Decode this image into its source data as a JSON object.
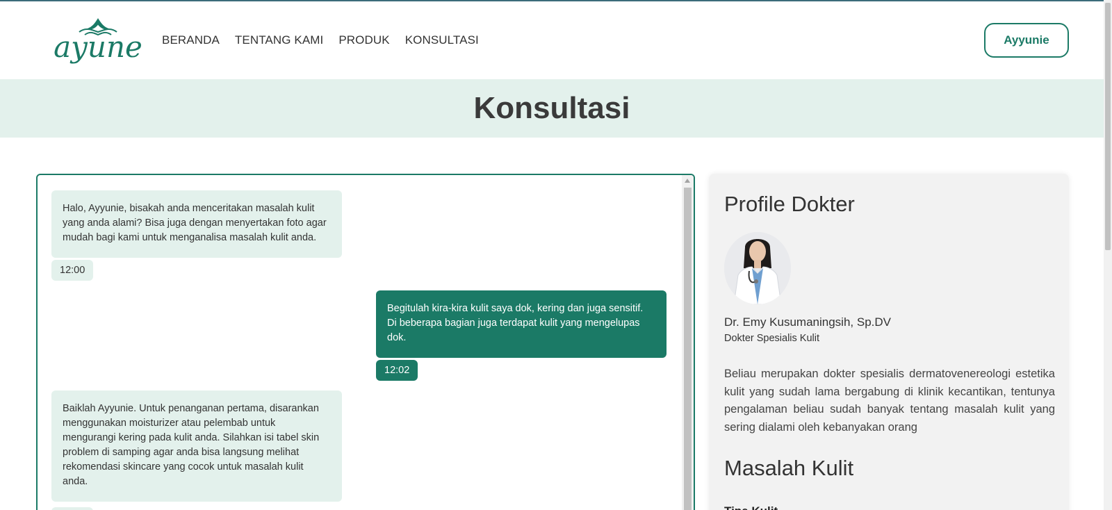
{
  "brand": {
    "logo_text": "ayune",
    "accent_color": "#1b7a66",
    "soft_color": "#e3f1ec"
  },
  "nav": {
    "items": [
      {
        "label": "BERANDA"
      },
      {
        "label": "TENTANG KAMI"
      },
      {
        "label": "PRODUK"
      },
      {
        "label": "KONSULTASI"
      }
    ],
    "user_button": "Ayyunie"
  },
  "page": {
    "title": "Konsultasi"
  },
  "chat": {
    "messages": [
      {
        "side": "incoming",
        "text": "Halo, Ayyunie, bisakah anda menceritakan masalah kulit yang anda alami? Bisa juga dengan menyertakan foto agar mudah bagi kami untuk menganalisa masalah kulit anda.",
        "time": "12:00"
      },
      {
        "side": "outgoing",
        "text": "Begitulah kira-kira kulit saya dok, kering dan juga sensitif. Di beberapa bagian juga terdapat kulit yang mengelupas dok.",
        "time": "12:02"
      },
      {
        "side": "incoming",
        "text": "Baiklah Ayyunie. Untuk penanganan pertama, disarankan menggunakan moisturizer atau pelembab untuk mengurangi kering pada kulit anda. Silahkan isi tabel skin problem di samping agar anda bisa langsung melihat rekomendasi skincare yang cocok untuk masalah kulit anda.",
        "time": ""
      }
    ]
  },
  "profile": {
    "heading": "Profile Dokter",
    "doctor_name": "Dr. Emy Kusumaningsih, Sp.DV",
    "doctor_role": "Dokter Spesialis Kulit",
    "description": "Beliau merupakan dokter spesialis dermatovenereologi estetika kulit yang sudah lama bergabung di klinik kecantikan, tentunya pengalaman beliau sudah banyak tentang masalah kulit yang sering dialami oleh kebanyakan orang",
    "skin_heading": "Masalah Kulit",
    "skin_type_label": "Tipe Kulit"
  }
}
